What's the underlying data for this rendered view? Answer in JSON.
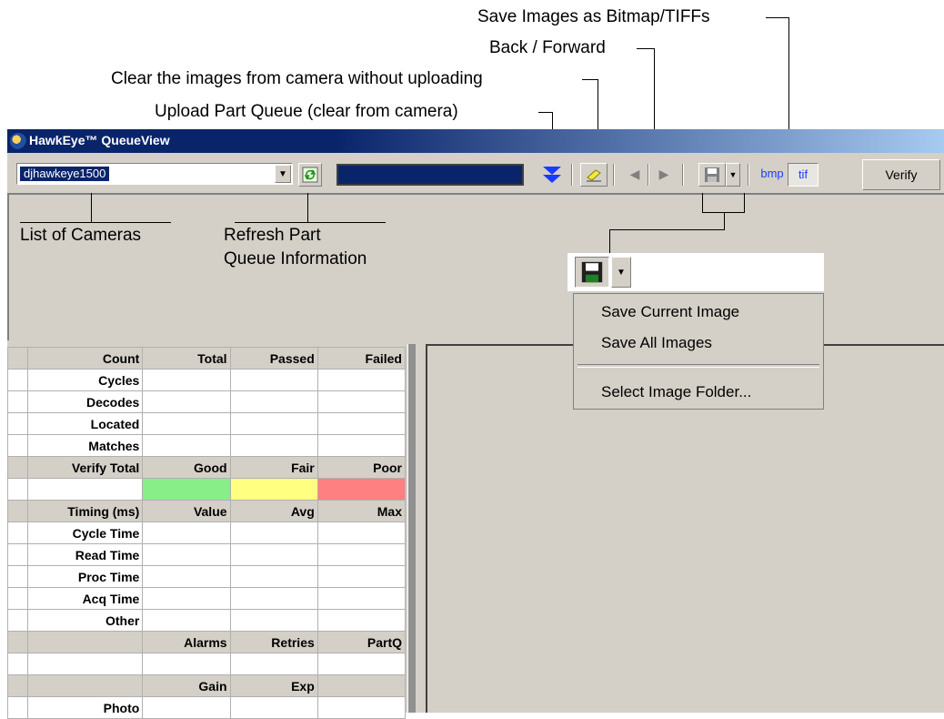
{
  "annotations": {
    "save_bitmap_tiff": "Save Images as Bitmap/TIFFs",
    "back_forward": "Back / Forward",
    "clear_images": "Clear the images from camera without uploading",
    "upload_queue": "Upload Part Queue (clear from camera)",
    "list_of_cameras": "List of Cameras",
    "refresh_line1": "Refresh Part",
    "refresh_line2": "Queue Information"
  },
  "window": {
    "title": "HawkEye™ QueueView",
    "icon": "hawkeye-app-icon"
  },
  "toolbar": {
    "camera_value": "djhawkeye1500",
    "bmp_label": "bmp",
    "tif_label": "tif",
    "verify_label": "Verify",
    "icons": [
      "refresh-icon",
      "upload-icon",
      "eraser-icon",
      "back-icon",
      "forward-icon",
      "save-icon",
      "bmp-icon",
      "tif-icon"
    ]
  },
  "save_menu": {
    "items": [
      "Save Current Image",
      "Save All Images",
      "Select Image Folder..."
    ]
  },
  "grid": {
    "rows": [
      {
        "type": "hdr",
        "cells": [
          "Count",
          "Total",
          "Passed",
          "Failed"
        ]
      },
      {
        "type": "data",
        "cells": [
          "Cycles",
          "",
          "",
          ""
        ]
      },
      {
        "type": "data",
        "cells": [
          "Decodes",
          "",
          "",
          ""
        ]
      },
      {
        "type": "data",
        "cells": [
          "Located",
          "",
          "",
          ""
        ]
      },
      {
        "type": "data",
        "cells": [
          "Matches",
          "",
          "",
          ""
        ]
      },
      {
        "type": "hdr",
        "cells": [
          "Verify Total",
          "Good",
          "Fair",
          "Poor"
        ]
      },
      {
        "type": "grade",
        "cells": [
          "",
          "",
          "",
          ""
        ]
      },
      {
        "type": "hdr",
        "cells": [
          "Timing (ms)",
          "Value",
          "Avg",
          "Max"
        ]
      },
      {
        "type": "data",
        "cells": [
          "Cycle Time",
          "",
          "",
          ""
        ]
      },
      {
        "type": "data",
        "cells": [
          "Read Time",
          "",
          "",
          ""
        ]
      },
      {
        "type": "data",
        "cells": [
          "Proc Time",
          "",
          "",
          ""
        ]
      },
      {
        "type": "data",
        "cells": [
          "Acq Time",
          "",
          "",
          ""
        ]
      },
      {
        "type": "data",
        "cells": [
          "Other",
          "",
          "",
          ""
        ]
      },
      {
        "type": "hdr",
        "cells": [
          "",
          "Alarms",
          "Retries",
          "PartQ"
        ]
      },
      {
        "type": "data",
        "cells": [
          "",
          "",
          "",
          ""
        ]
      },
      {
        "type": "hdr",
        "cells": [
          "",
          "Gain",
          "Exp",
          ""
        ]
      },
      {
        "type": "data",
        "cells": [
          "Photo",
          "",
          "",
          ""
        ]
      }
    ],
    "grade_colors": {
      "good": "#88ee88",
      "fair": "#ffff80",
      "poor": "#ff8080"
    }
  },
  "colors": {
    "title_active": "#0a246a",
    "face": "#d4d0c8",
    "upload_arrow": "#1a3cff"
  }
}
